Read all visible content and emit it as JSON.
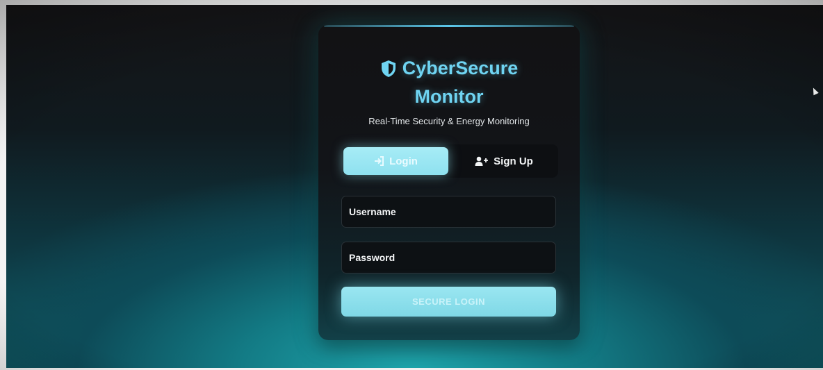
{
  "brand": {
    "title_line1": "CyberSecure",
    "title_line2": "Monitor",
    "subtitle": "Real-Time Security & Energy Monitoring",
    "icon": "shield-icon",
    "accent_color": "#6fd4f2"
  },
  "auth_tabs": {
    "active": "login",
    "login_label": "Login",
    "login_icon": "sign-in-icon",
    "signup_label": "Sign Up",
    "signup_icon": "user-plus-icon"
  },
  "form": {
    "username_placeholder": "Username",
    "password_placeholder": "Password",
    "submit_label": "SECURE LOGIN",
    "button_color": "#8fe1ef"
  }
}
